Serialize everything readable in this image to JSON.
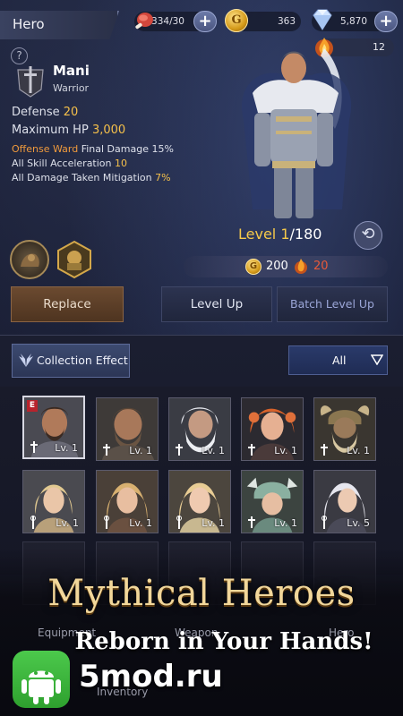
{
  "header": {
    "title": "Hero",
    "resources": {
      "meat": "334/30",
      "gold": "363",
      "gems": "5,870",
      "fire": "12"
    },
    "gold_icon_glyph": "G"
  },
  "hero": {
    "name": "Mani",
    "class": "Warrior",
    "help_glyph": "?",
    "stats": {
      "defense_label": "Defense",
      "defense_value": "20",
      "hp_label": "Maximum HP",
      "hp_value": "3,000",
      "ward_label": "Offense Ward",
      "ward_text": "Final Damage 15%",
      "accel_label": "All Skill Acceleration",
      "accel_value": "10",
      "mitigation_label": "All Damage Taken Mitigation",
      "mitigation_value": "7%"
    },
    "level": {
      "label": "Level",
      "current": "1",
      "max": "/180"
    },
    "cost": {
      "gold": "200",
      "fire": "20"
    },
    "rotate_glyph": "⟲"
  },
  "buttons": {
    "replace": "Replace",
    "level_up": "Level Up",
    "batch_level_up": "Batch Level Up"
  },
  "collection": {
    "effect_label": "Collection Effect",
    "filter_value": "All"
  },
  "cards": [
    {
      "lv": "Lv. 1",
      "badge": "E",
      "selected": true
    },
    {
      "lv": "Lv. 1"
    },
    {
      "lv": "Lv. 1"
    },
    {
      "lv": "Lv. 1"
    },
    {
      "lv": "Lv. 1"
    },
    {
      "lv": "Lv. 1"
    },
    {
      "lv": "Lv. 1"
    },
    {
      "lv": "Lv. 1"
    },
    {
      "lv": "Lv. 1"
    },
    {
      "lv": "Lv. 5"
    }
  ],
  "bottom_tabs": {
    "equipment": "Equipment",
    "weapon": "Weapon",
    "hero": "Hero",
    "inventory": "Inventory"
  },
  "banner": {
    "title": "Mythical Heroes",
    "subtitle": "Reborn in Your Hands!",
    "watermark": "5mod.ru"
  }
}
